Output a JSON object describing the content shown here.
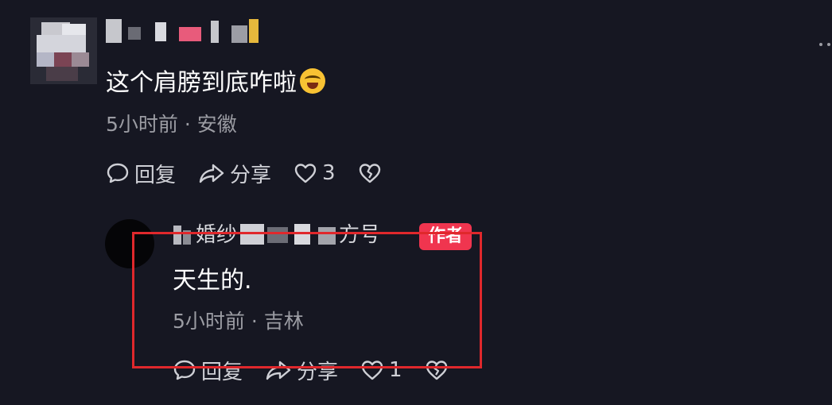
{
  "comments": [
    {
      "text": "这个肩膀到底咋啦",
      "emoji": "laughing-crying-emoji",
      "meta": "5小时前 · 安徽",
      "actions": {
        "reply_label": "回复",
        "share_label": "分享",
        "like_count": "3"
      }
    }
  ],
  "reply": {
    "username_visible_fragments": [
      "婚纱",
      "方号"
    ],
    "badge": "作者",
    "text": "天生的.",
    "meta": "5小时前 · 吉林",
    "actions": {
      "reply_label": "回复",
      "share_label": "分享",
      "like_count": "1"
    }
  },
  "colors": {
    "background": "#161722",
    "badge": "#f0354f",
    "highlight": "#e0282c",
    "meta_text": "#9b9ca3"
  },
  "icons": [
    "comment-bubble-icon",
    "share-arrow-icon",
    "heart-icon",
    "broken-heart-icon",
    "more-options-icon"
  ]
}
